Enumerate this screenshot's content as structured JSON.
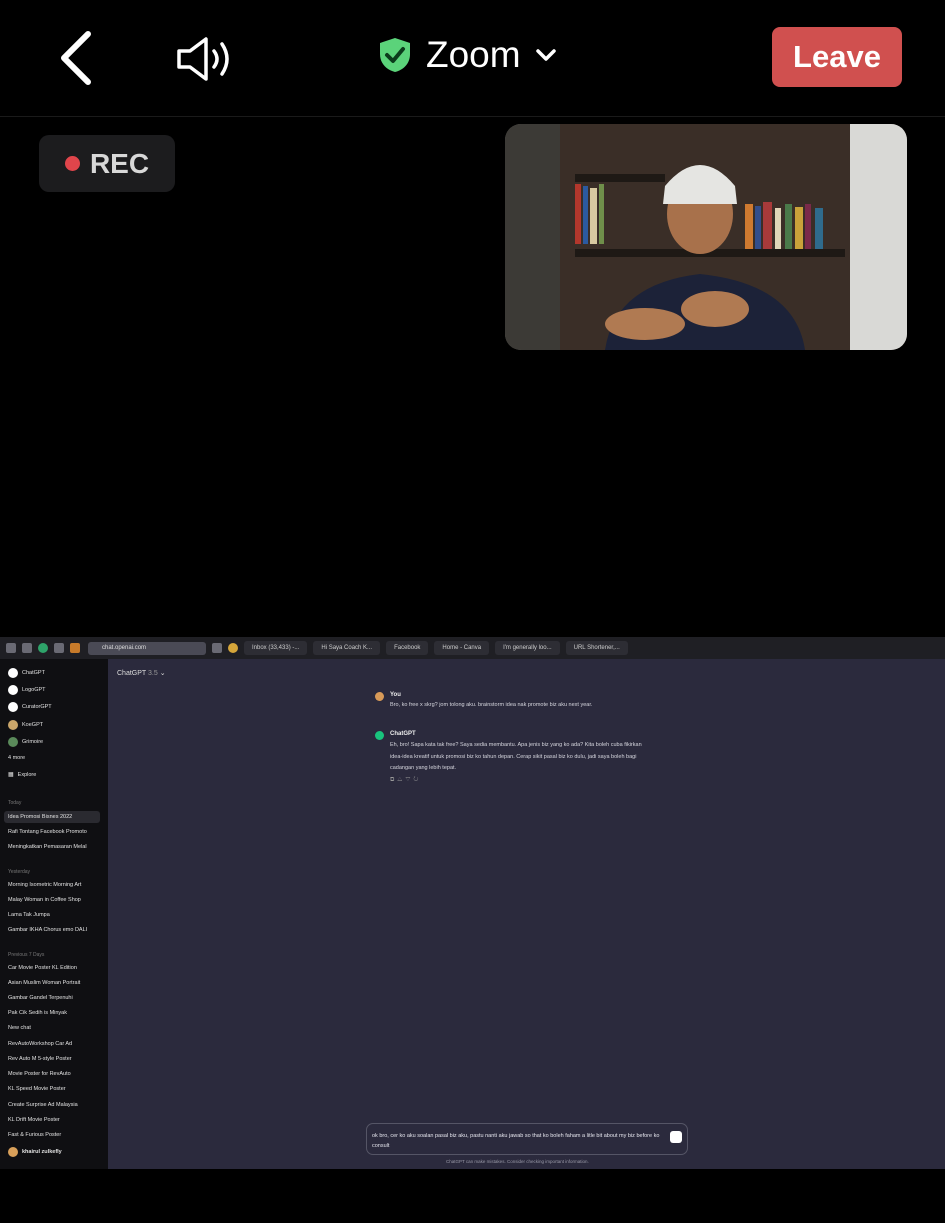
{
  "zoom": {
    "title": "Zoom",
    "leave_label": "Leave",
    "rec_label": "REC",
    "colors": {
      "leave": "#d0504f",
      "shield": "#5bd37a",
      "rec_dot": "#e0454b"
    }
  },
  "browser": {
    "url": "chat.openai.com",
    "tabs": [
      "Inbox (33,433) -...",
      "Hi Saya Coach K...",
      "Facebook",
      "Home - Canva",
      "I'm generally loo...",
      "URL Shortener,..."
    ]
  },
  "sidebar": {
    "gpts": [
      "ChatGPT",
      "LogoGPT",
      "CuratorGPT",
      "KoeGPT",
      "Grimoire"
    ],
    "more_label": "4 more",
    "explore_label": "Explore",
    "today_header": "Today",
    "today": [
      "Idea Promosi Bisnes 2022",
      "Rafi Tontang Facebook Promoto",
      "Meningkatkan Pemasaran Melal"
    ],
    "yesterday_header": "Yesterday",
    "yesterday": [
      "Morning Isometric Morning Art",
      "Malay Woman in Coffee Shop",
      "Lama Tak Jumpa",
      "Gambar IKHA Chorus emo DALI"
    ],
    "previous_header": "Previous 7 Days",
    "previous": [
      "Car Movie Poster KL Edition",
      "Asian Muslim Woman Portrait",
      "Gambar Gandel Terpenuhi",
      "Pak Cik Sedih is Minyak",
      "New chat",
      "RevAutoWorkshop Car Ad",
      "Rev Auto M 5-style Poster",
      "Movie Poster for RevAuto",
      "KL Speed Movie Poster",
      "Create Surprise Ad Malaysia",
      "KL Drift Movie Poster",
      "Fast & Furious Poster"
    ],
    "user": "khairul zulkefly"
  },
  "chat": {
    "model": "ChatGPT",
    "version": "3.5",
    "user_name": "You",
    "user_message": "Bro, ko free x skrg? jom tolong aku. brainstorm idea nak promote biz aku next year.",
    "bot_name": "ChatGPT",
    "bot_message": "Eh, bro! Sapa kata tak free? Saya sedia membantu. Apa jenis biz yang ko ada? Kita boleh cuba fikirkan idea-idea kreatif untuk promosi biz ko tahun depan. Cerap sikit pasal biz ko dulu, jadi saya boleh bagi cadangan yang lebih tepat.",
    "input_text": "ok bro, cer ko aku soalan pasal biz aku, pastu nanti aku jawab so that ko boleh faham a litle bit about my biz before ko consult",
    "disclaimer": "ChatGPT can make mistakes. Consider checking important information."
  }
}
